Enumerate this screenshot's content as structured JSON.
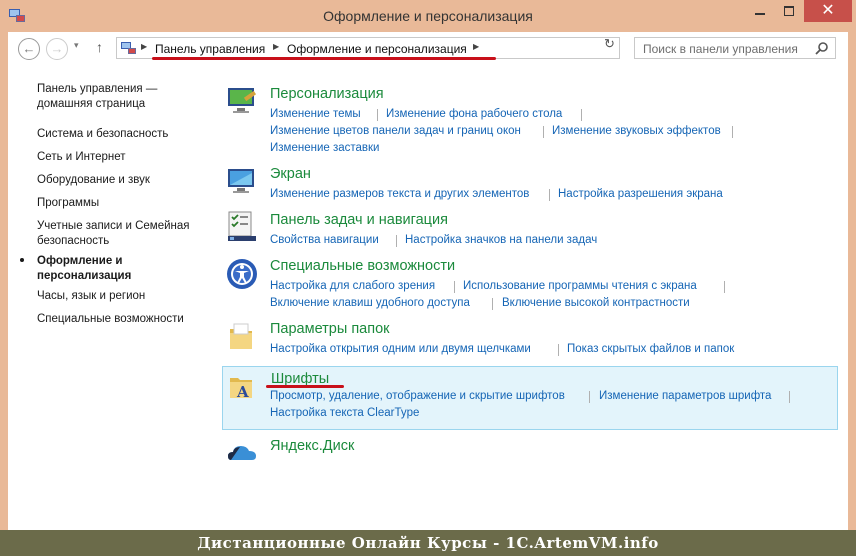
{
  "window": {
    "title": "Оформление и персонализация",
    "close_glyph": "✕"
  },
  "nav": {
    "back_glyph": "←",
    "forward_glyph": "→",
    "recent_glyph": "▾",
    "up_glyph": "↑",
    "refresh_glyph": "↻"
  },
  "breadcrumb": [
    "Панель управления",
    "Оформление и персонализация"
  ],
  "search": {
    "placeholder": "Поиск в панели управления"
  },
  "sidebar": {
    "items": [
      "Панель управления — домашняя страница",
      "Система и безопасность",
      "Сеть и Интернет",
      "Оборудование и звук",
      "Программы",
      "Учетные записи и Семейная безопасность",
      "Оформление и персонализация",
      "Часы, язык и регион",
      "Специальные возможности"
    ],
    "current_index": 6
  },
  "categories": [
    {
      "title": "Персонализация",
      "icon": "personalization-icon",
      "links": [
        "Изменение темы",
        "Изменение фона рабочего стола",
        "Изменение цветов панели задач и границ окон",
        "Изменение звуковых эффектов",
        "Изменение заставки"
      ]
    },
    {
      "title": "Экран",
      "icon": "display-icon",
      "links": [
        "Изменение размеров текста и других элементов",
        "Настройка разрешения экрана"
      ]
    },
    {
      "title": "Панель задач и навигация",
      "icon": "taskbar-icon",
      "links": [
        "Свойства навигации",
        "Настройка значков на панели задач"
      ]
    },
    {
      "title": "Специальные возможности",
      "icon": "ease-of-access-icon",
      "links": [
        "Настройка для слабого зрения",
        "Использование программы чтения с экрана",
        "Включение клавиш удобного доступа",
        "Включение высокой контрастности"
      ]
    },
    {
      "title": "Параметры папок",
      "icon": "folder-options-icon",
      "links": [
        "Настройка открытия одним или двумя щелчками",
        "Показ скрытых файлов и папок"
      ]
    },
    {
      "title": "Шрифты",
      "icon": "fonts-icon",
      "links": [
        "Просмотр, удаление, отображение и скрытие шрифтов",
        "Изменение параметров шрифта",
        "Настройка текста ClearType"
      ]
    },
    {
      "title": "Яндекс.Диск",
      "icon": "yandex-disk-icon",
      "links": []
    }
  ],
  "banner": {
    "text": "Дистанционные Онлайн Курсы - 1C.ArtemVM.info"
  },
  "colors": {
    "accent_green": "#1b8a3c",
    "link_blue": "#1565b5",
    "annotation_red": "#c8101a",
    "highlight": "#e3f4fb"
  }
}
